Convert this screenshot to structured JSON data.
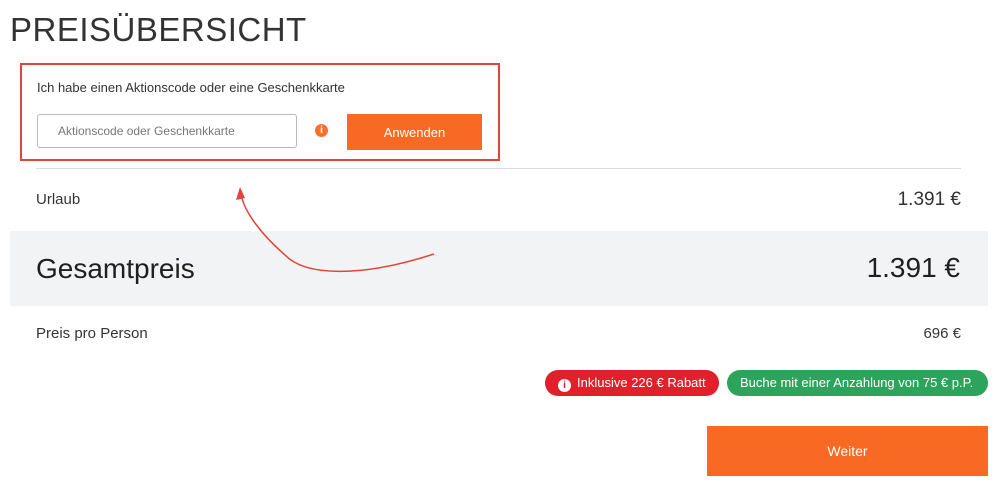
{
  "page": {
    "title": "PREISÜBERSICHT"
  },
  "promo": {
    "label": "Ich habe einen Aktionscode oder eine Geschenkkarte",
    "input_placeholder": "Aktionscode oder Geschenkkarte",
    "input_value": "",
    "info_icon": "info-icon",
    "apply_label": "Anwenden"
  },
  "pricing": {
    "urlaub_label": "Urlaub",
    "urlaub_value": "1.391 €",
    "total_label": "Gesamtpreis",
    "total_value": "1.391 €",
    "per_person_label": "Preis pro Person",
    "per_person_value": "696 €"
  },
  "badges": {
    "discount": "Inklusive 226 € Rabatt",
    "deposit": "Buche mit einer Anzahlung von 75 € p.P."
  },
  "actions": {
    "next_label": "Weiter"
  },
  "colors": {
    "accent": "#f86a23",
    "highlight_border": "#e0453b",
    "discount_badge": "#e2202c",
    "deposit_badge": "#2ea35c",
    "total_band": "#f1f3f4"
  }
}
